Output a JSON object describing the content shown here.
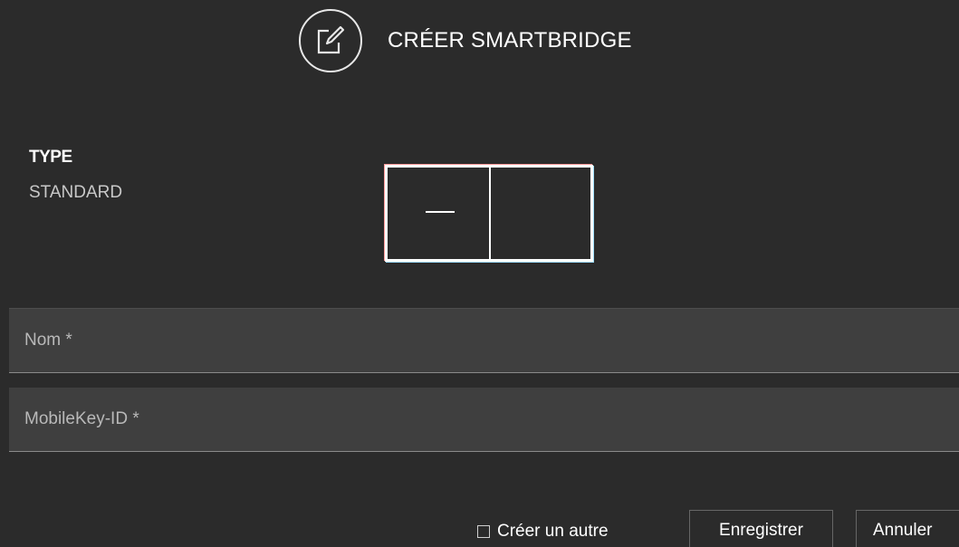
{
  "dialog": {
    "title": "CRÉER SMARTBRIDGE",
    "header_icon": "edit-icon"
  },
  "type": {
    "label": "TYPE",
    "value": "STANDARD"
  },
  "fields": {
    "name": {
      "placeholder": "Nom *",
      "value": ""
    },
    "mobilekey_id": {
      "placeholder": "MobileKey-ID *",
      "value": ""
    }
  },
  "footer": {
    "create_another_label": "Créer un autre",
    "create_another_checked": false,
    "save_label": "Enregistrer",
    "cancel_label": "Annuler"
  }
}
